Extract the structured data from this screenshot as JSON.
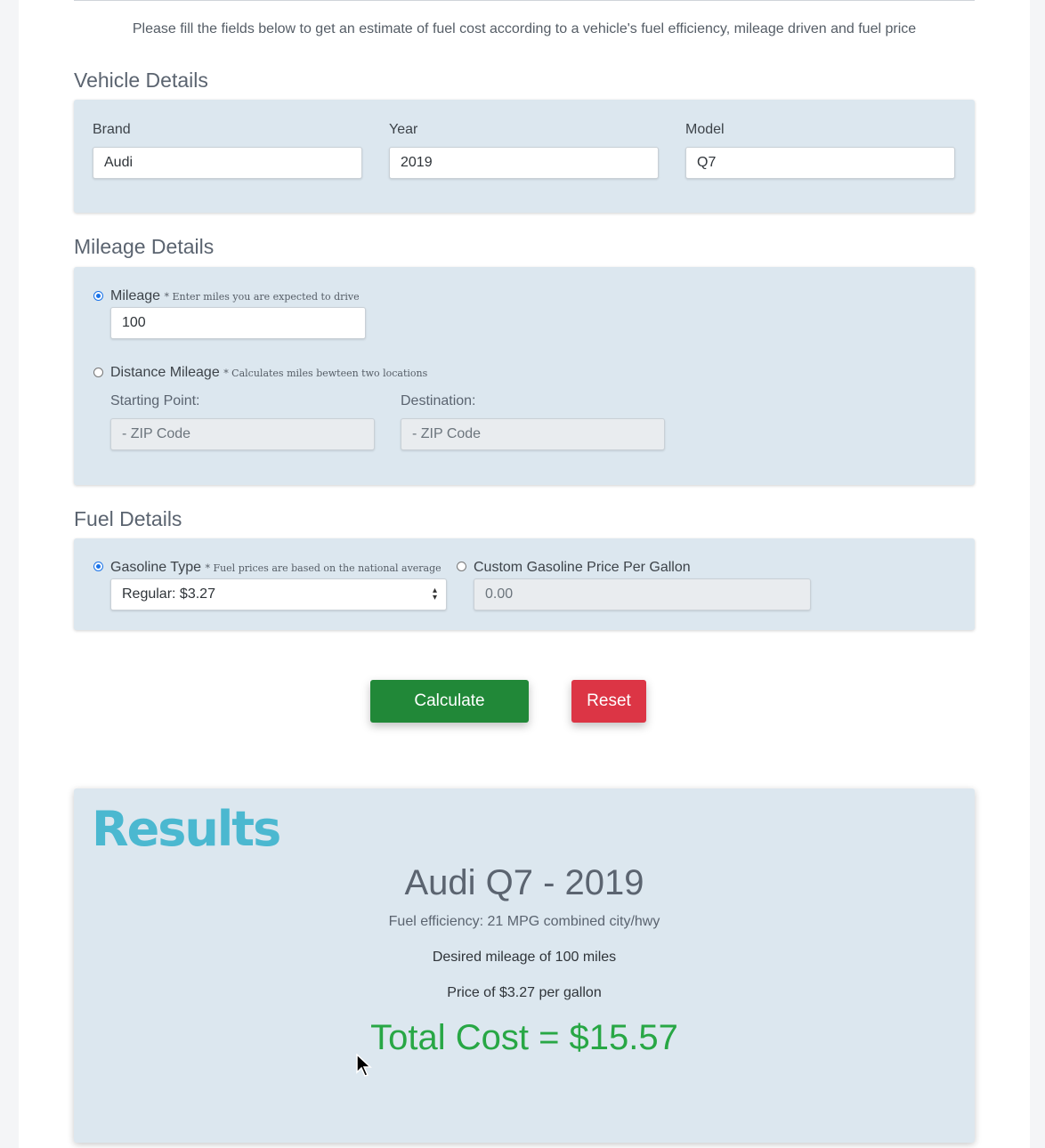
{
  "intro_text": "Please fill the fields below to get an estimate of fuel cost according to a vehicle's fuel efficiency, mileage driven and fuel price",
  "vehicle": {
    "title": "Vehicle Details",
    "brand_label": "Brand",
    "brand_value": "Audi",
    "year_label": "Year",
    "year_value": "2019",
    "model_label": "Model",
    "model_value": "Q7"
  },
  "mileage": {
    "title": "Mileage Details",
    "mileage_label": "Mileage",
    "mileage_hint": "* Enter miles you are expected to drive",
    "mileage_value": "100",
    "mileage_selected": true,
    "distance_label": "Distance Mileage",
    "distance_hint": "* Calculates miles bewteen two locations",
    "start_label": "Starting Point:",
    "start_placeholder": "- ZIP Code",
    "dest_label": "Destination:",
    "dest_placeholder": "- ZIP Code"
  },
  "fuel": {
    "title": "Fuel Details",
    "gas_label": "Gasoline Type",
    "gas_hint": "* Fuel prices are based on the national average",
    "gas_selected_option": "Regular: $3.27",
    "gas_type_selected": true,
    "custom_label": "Custom Gasoline Price Per Gallon",
    "custom_placeholder": "0.00"
  },
  "buttons": {
    "calculate": "Calculate",
    "reset": "Reset"
  },
  "results": {
    "heading": "Results",
    "car_title": "Audi Q7 - 2019",
    "efficiency": "Fuel efficiency: 21 MPG combined city/hwy",
    "desired_mileage": "Desired mileage of 100 miles",
    "price": "Price of $3.27 per gallon",
    "total": "Total Cost = $15.57"
  },
  "colors": {
    "card_bg": "#dce7ef",
    "calculate_bg": "#218838",
    "reset_bg": "#dc3545",
    "results_logo": "#4bb8d0",
    "total_text": "#28a745",
    "radio_accent": "#1a73e8"
  }
}
